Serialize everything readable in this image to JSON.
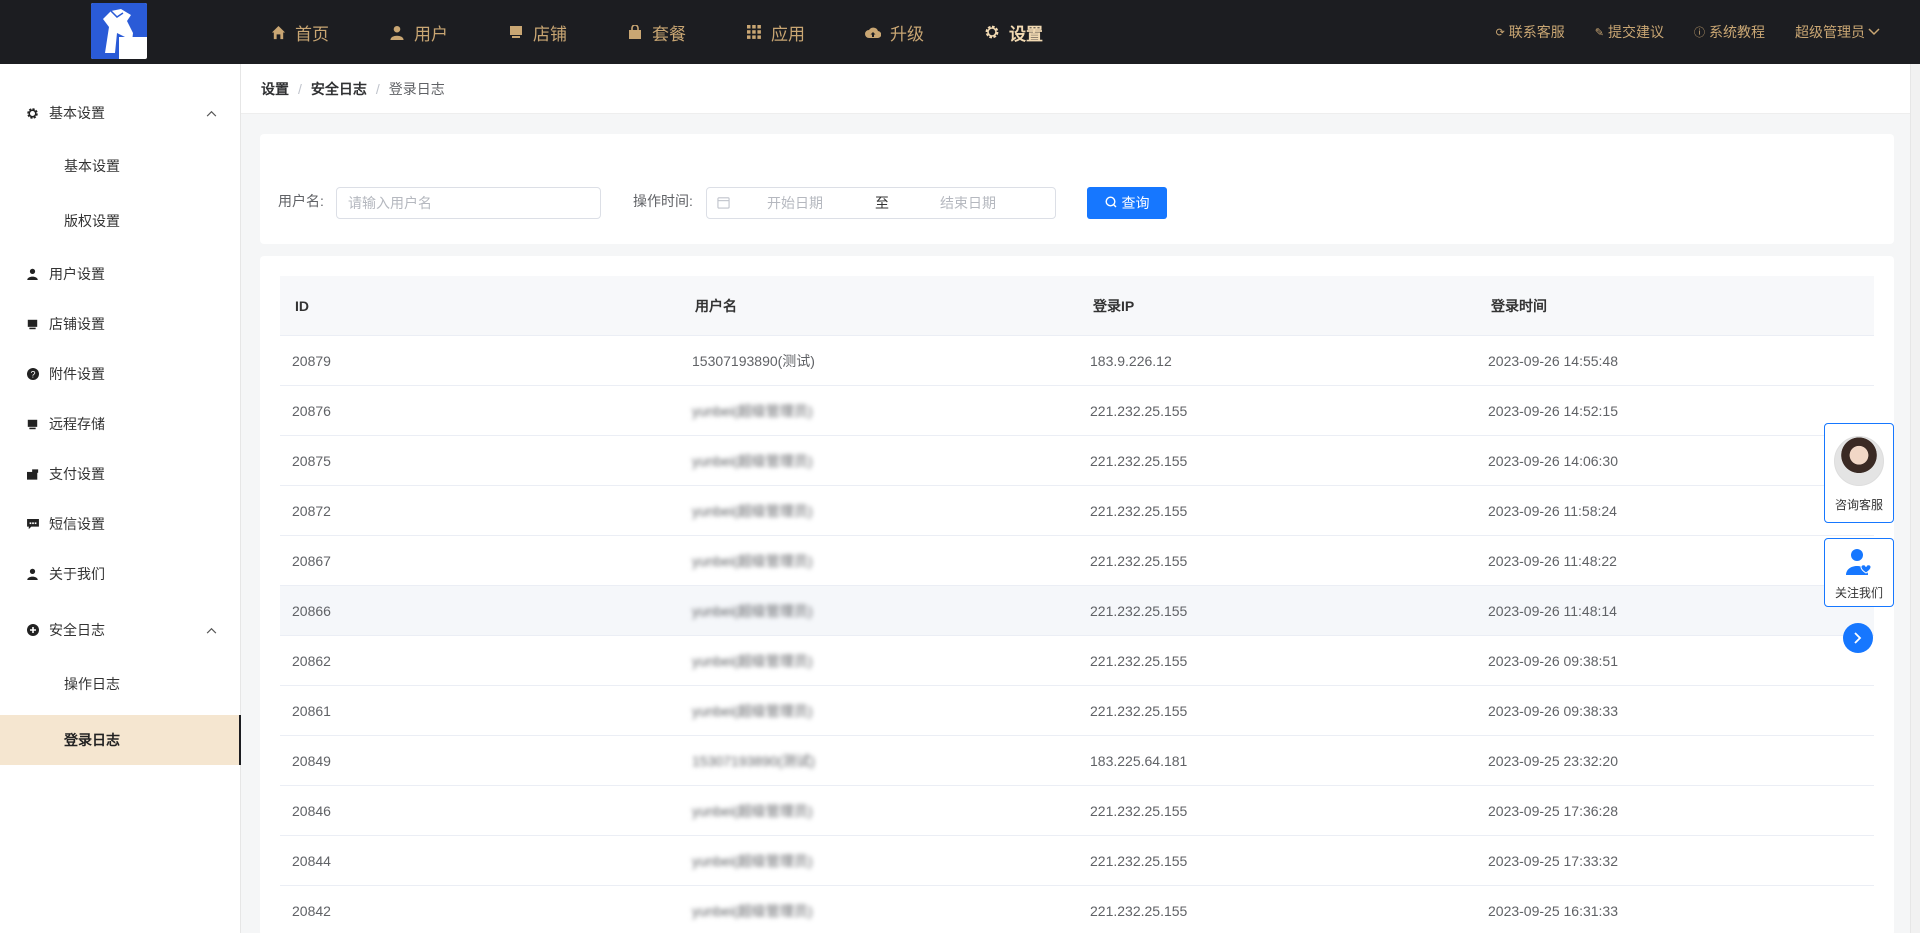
{
  "colors": {
    "topbar": "#1c1d21",
    "nav_text": "#c9a673",
    "primary": "#1677ff",
    "sidebar_active": "#f5e6d0"
  },
  "nav": [
    {
      "label": "首页",
      "icon": "home-icon"
    },
    {
      "label": "用户",
      "icon": "user-icon"
    },
    {
      "label": "店铺",
      "icon": "store-icon"
    },
    {
      "label": "套餐",
      "icon": "package-icon"
    },
    {
      "label": "应用",
      "icon": "apps-icon"
    },
    {
      "label": "升级",
      "icon": "cloud-upload-icon"
    },
    {
      "label": "设置",
      "icon": "gear-icon",
      "active": true
    }
  ],
  "top_right": {
    "support": "联系客服",
    "feedback": "提交建议",
    "tutorial": "系统教程",
    "user": "超级管理员"
  },
  "sidebar": {
    "basic_group": "基本设置",
    "basic_settings": "基本设置",
    "copyright": "版权设置",
    "user_settings": "用户设置",
    "store_settings": "店铺设置",
    "attachment": "附件设置",
    "remote_storage": "远程存储",
    "payment": "支付设置",
    "sms": "短信设置",
    "about": "关于我们",
    "security_group": "安全日志",
    "op_log": "操作日志",
    "login_log": "登录日志"
  },
  "breadcrumb": [
    "设置",
    "安全日志",
    "登录日志"
  ],
  "filter": {
    "username_label": "用户名:",
    "username_placeholder": "请输入用户名",
    "time_label": "操作时间:",
    "start_placeholder": "开始日期",
    "to": "至",
    "end_placeholder": "结束日期",
    "query": "查询"
  },
  "table": {
    "headers": [
      "ID",
      "用户名",
      "登录IP",
      "登录时间"
    ],
    "rows": [
      {
        "id": "20879",
        "user": "15307193890(测试)",
        "ip": "183.9.226.12",
        "time": "2023-09-26 14:55:48"
      },
      {
        "id": "20876",
        "user": "yunbei(超级管理员)",
        "ip": "221.232.25.155",
        "time": "2023-09-26 14:52:15"
      },
      {
        "id": "20875",
        "user": "yunbei(超级管理员)",
        "ip": "221.232.25.155",
        "time": "2023-09-26 14:06:30"
      },
      {
        "id": "20872",
        "user": "yunbei(超级管理员)",
        "ip": "221.232.25.155",
        "time": "2023-09-26 11:58:24"
      },
      {
        "id": "20867",
        "user": "yunbei(超级管理员)",
        "ip": "221.232.25.155",
        "time": "2023-09-26 11:48:22"
      },
      {
        "id": "20866",
        "user": "yunbei(超级管理员)",
        "ip": "221.232.25.155",
        "time": "2023-09-26 11:48:14"
      },
      {
        "id": "20862",
        "user": "yunbei(超级管理员)",
        "ip": "221.232.25.155",
        "time": "2023-09-26 09:38:51"
      },
      {
        "id": "20861",
        "user": "yunbei(超级管理员)",
        "ip": "221.232.25.155",
        "time": "2023-09-26 09:38:33"
      },
      {
        "id": "20849",
        "user": "15307193890(测试)",
        "ip": "183.225.64.181",
        "time": "2023-09-25 23:32:20"
      },
      {
        "id": "20846",
        "user": "yunbei(超级管理员)",
        "ip": "221.232.25.155",
        "time": "2023-09-25 17:36:28"
      },
      {
        "id": "20844",
        "user": "yunbei(超级管理员)",
        "ip": "221.232.25.155",
        "time": "2023-09-25 17:33:32"
      },
      {
        "id": "20842",
        "user": "yunbei(超级管理员)",
        "ip": "221.232.25.155",
        "time": "2023-09-25 16:31:33"
      }
    ]
  },
  "float": {
    "consult": "咨询客服",
    "follow": "关注我们"
  }
}
